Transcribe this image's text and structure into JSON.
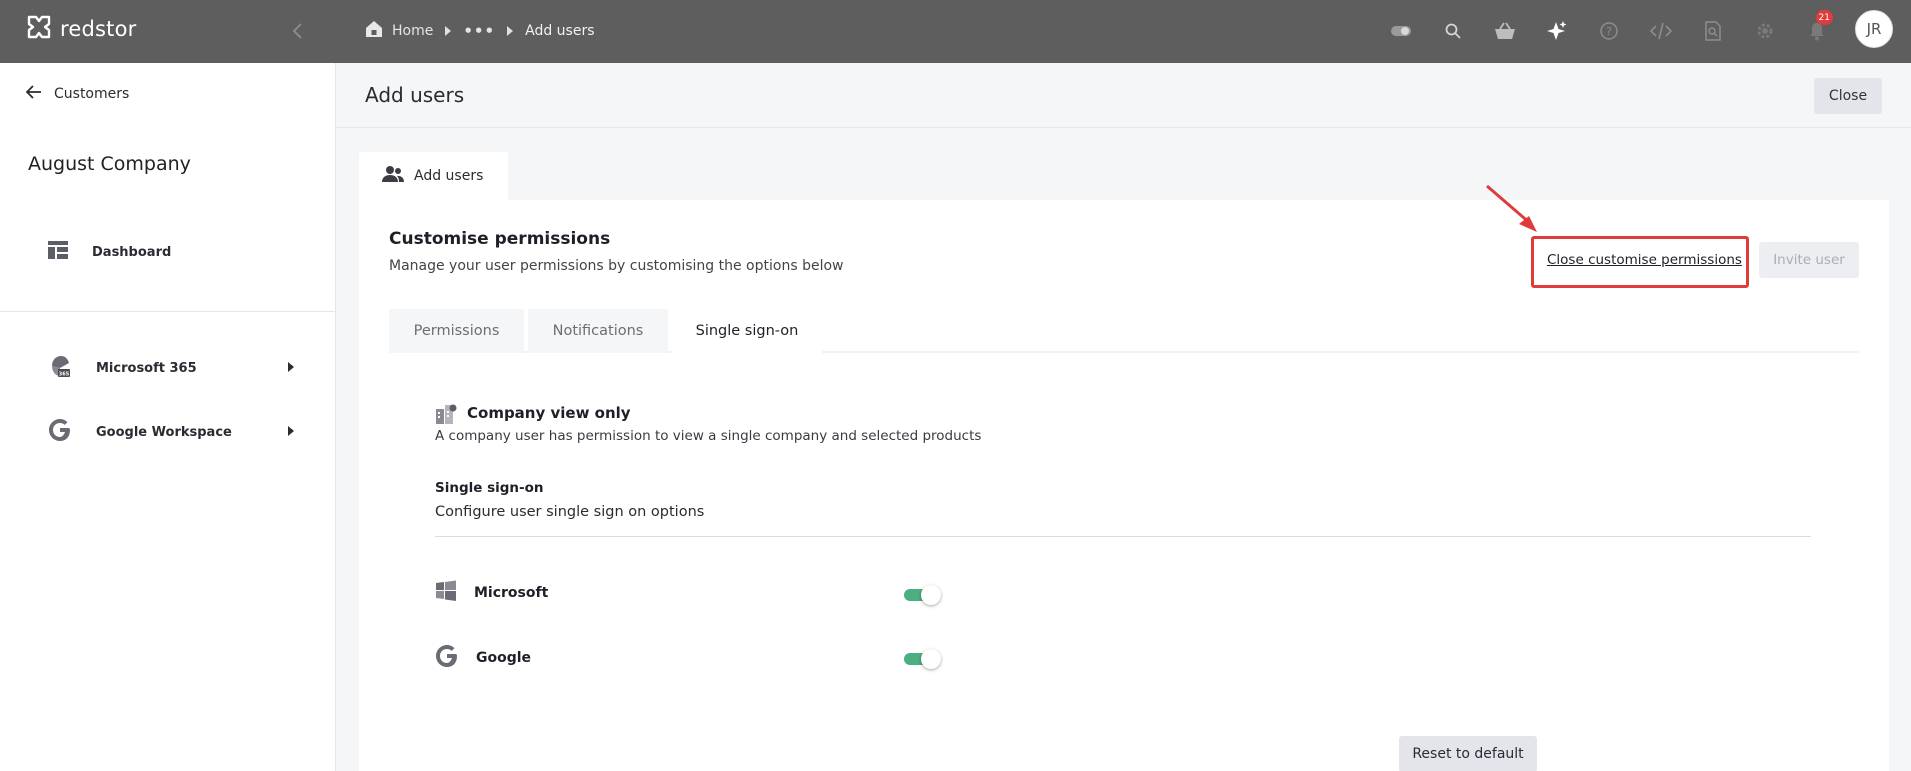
{
  "topbar": {
    "brand": "redstor",
    "breadcrumb": {
      "home": "Home",
      "ellipsis": "•••",
      "current": "Add users"
    },
    "notifications_count": "21",
    "user_initials": "JR",
    "icons": [
      "toggle-icon",
      "search-icon",
      "basket-icon",
      "sparkle-icon",
      "help-icon",
      "code-icon",
      "search-document-icon",
      "gear-icon",
      "bell-icon"
    ]
  },
  "sidebar": {
    "back_label": "Customers",
    "company_name": "August Company",
    "items": [
      {
        "label": "Dashboard",
        "icon": "dashboard-icon"
      },
      {
        "label": "Microsoft 365",
        "icon": "microsoft-365-icon"
      },
      {
        "label": "Google Workspace",
        "icon": "google-icon"
      }
    ]
  },
  "header": {
    "title": "Add users",
    "close_label": "Close"
  },
  "tab": {
    "label": "Add users"
  },
  "card": {
    "title": "Customise permissions",
    "subtitle": "Manage your user permissions by customising the options below",
    "close_customise_label": "Close customise permissions",
    "invite_label": "Invite user",
    "subtabs": [
      {
        "label": "Permissions",
        "active": false
      },
      {
        "label": "Notifications",
        "active": false
      },
      {
        "label": "Single sign-on",
        "active": true
      }
    ]
  },
  "permission": {
    "title": "Company view only",
    "description": "A company user has permission to view a single company and selected products"
  },
  "sso": {
    "label": "Single sign-on",
    "description": "Configure user single sign on options",
    "providers": [
      {
        "name": "Microsoft",
        "enabled": true
      },
      {
        "name": "Google",
        "enabled": true
      }
    ],
    "reset_label": "Reset to default"
  },
  "colors": {
    "topbar": "#5e5e5e",
    "toggle_on": "#4caf7f",
    "highlight": "#e03b3b"
  }
}
